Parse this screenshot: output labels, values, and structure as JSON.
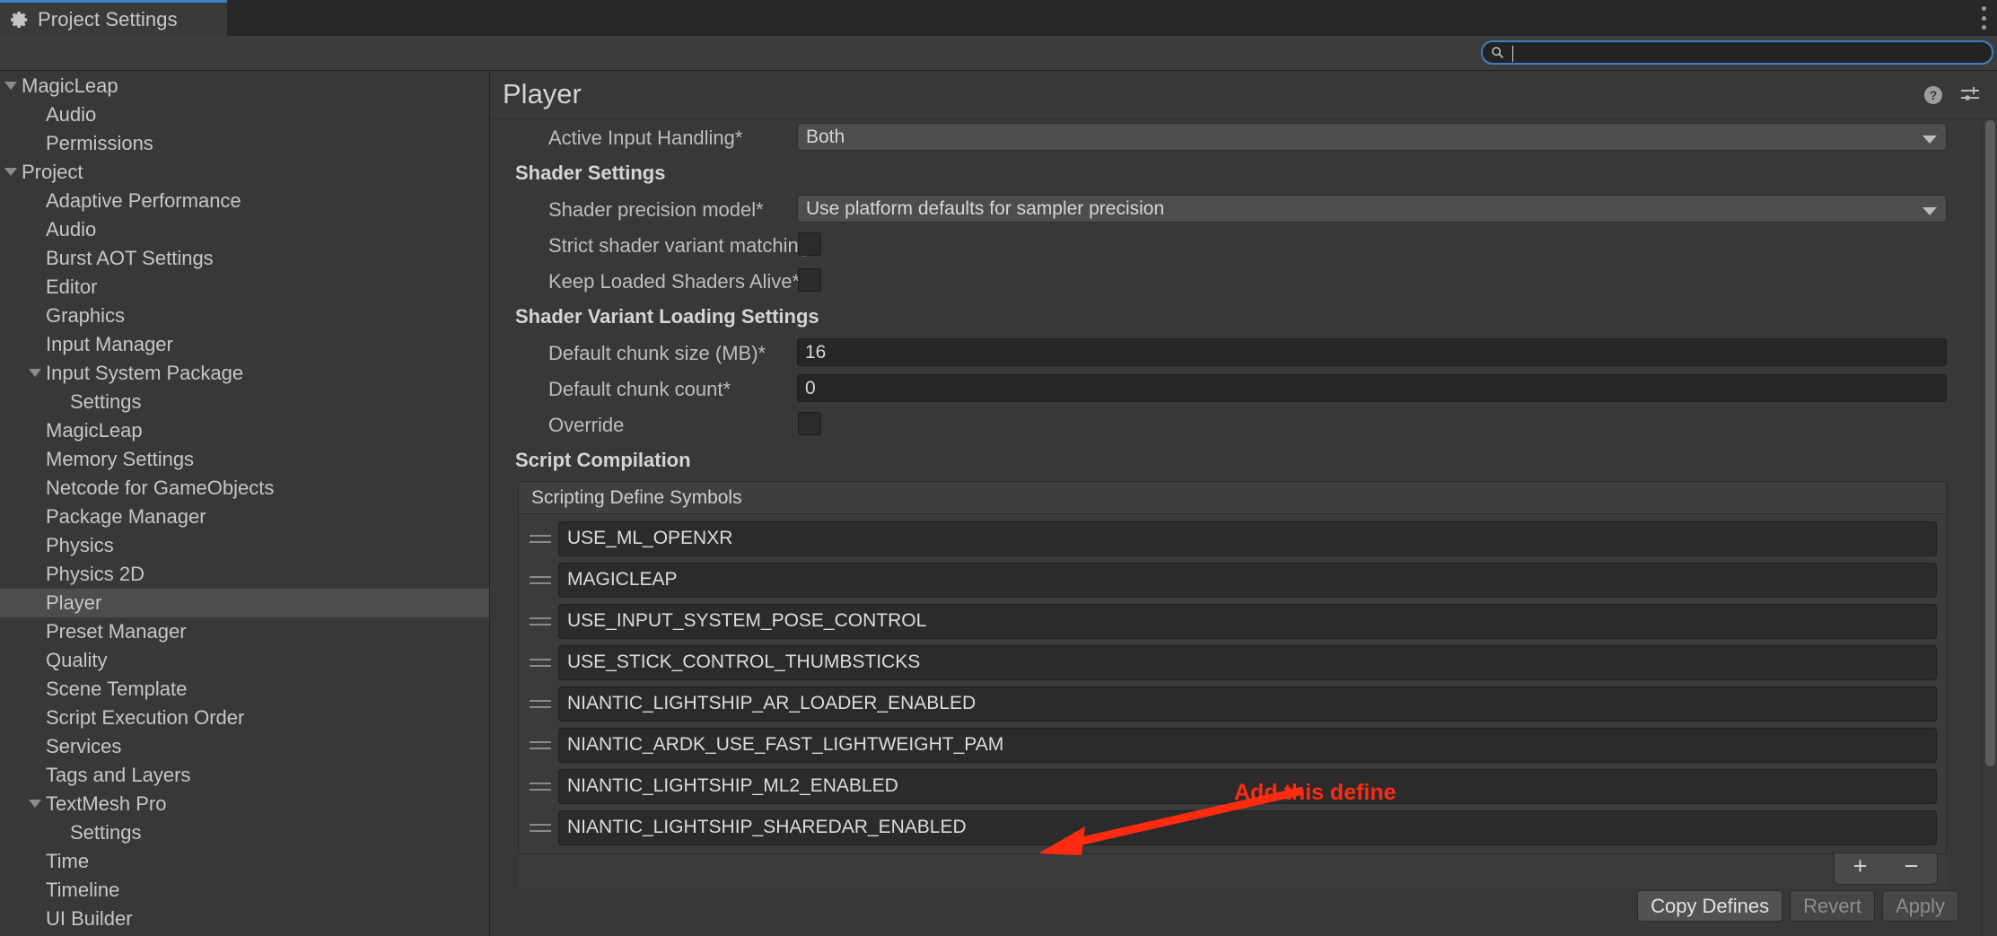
{
  "window": {
    "tab_label": "Project Settings",
    "gear_icon": "gear-icon",
    "kebab_icon": "kebab-menu-icon"
  },
  "search": {
    "icon": "search-icon",
    "value": "",
    "placeholder": ""
  },
  "sidebar": {
    "items": [
      {
        "label": "MagicLeap",
        "depth": 0,
        "expandable": true,
        "selected": false
      },
      {
        "label": "Audio",
        "depth": 1,
        "expandable": false,
        "selected": false
      },
      {
        "label": "Permissions",
        "depth": 1,
        "expandable": false,
        "selected": false
      },
      {
        "label": "Project",
        "depth": 0,
        "expandable": true,
        "selected": false
      },
      {
        "label": "Adaptive Performance",
        "depth": 1,
        "expandable": false,
        "selected": false
      },
      {
        "label": "Audio",
        "depth": 1,
        "expandable": false,
        "selected": false
      },
      {
        "label": "Burst AOT Settings",
        "depth": 1,
        "expandable": false,
        "selected": false
      },
      {
        "label": "Editor",
        "depth": 1,
        "expandable": false,
        "selected": false
      },
      {
        "label": "Graphics",
        "depth": 1,
        "expandable": false,
        "selected": false
      },
      {
        "label": "Input Manager",
        "depth": 1,
        "expandable": false,
        "selected": false
      },
      {
        "label": "Input System Package",
        "depth": 1,
        "expandable": true,
        "selected": false
      },
      {
        "label": "Settings",
        "depth": 2,
        "expandable": false,
        "selected": false
      },
      {
        "label": "MagicLeap",
        "depth": 1,
        "expandable": false,
        "selected": false
      },
      {
        "label": "Memory Settings",
        "depth": 1,
        "expandable": false,
        "selected": false
      },
      {
        "label": "Netcode for GameObjects",
        "depth": 1,
        "expandable": false,
        "selected": false
      },
      {
        "label": "Package Manager",
        "depth": 1,
        "expandable": false,
        "selected": false
      },
      {
        "label": "Physics",
        "depth": 1,
        "expandable": false,
        "selected": false
      },
      {
        "label": "Physics 2D",
        "depth": 1,
        "expandable": false,
        "selected": false
      },
      {
        "label": "Player",
        "depth": 1,
        "expandable": false,
        "selected": true
      },
      {
        "label": "Preset Manager",
        "depth": 1,
        "expandable": false,
        "selected": false
      },
      {
        "label": "Quality",
        "depth": 1,
        "expandable": false,
        "selected": false
      },
      {
        "label": "Scene Template",
        "depth": 1,
        "expandable": false,
        "selected": false
      },
      {
        "label": "Script Execution Order",
        "depth": 1,
        "expandable": false,
        "selected": false
      },
      {
        "label": "Services",
        "depth": 1,
        "expandable": false,
        "selected": false
      },
      {
        "label": "Tags and Layers",
        "depth": 1,
        "expandable": false,
        "selected": false
      },
      {
        "label": "TextMesh Pro",
        "depth": 1,
        "expandable": true,
        "selected": false
      },
      {
        "label": "Settings",
        "depth": 2,
        "expandable": false,
        "selected": false
      },
      {
        "label": "Time",
        "depth": 1,
        "expandable": false,
        "selected": false
      },
      {
        "label": "Timeline",
        "depth": 1,
        "expandable": false,
        "selected": false
      },
      {
        "label": "UI Builder",
        "depth": 1,
        "expandable": false,
        "selected": false
      }
    ]
  },
  "panel": {
    "title": "Player",
    "help_icon": "help-icon",
    "preset_icon": "preset-settings-icon",
    "rows": [
      {
        "kind": "field-dropdown",
        "label": "Active Input Handling*",
        "value": "Both"
      },
      {
        "kind": "section",
        "label": "Shader Settings"
      },
      {
        "kind": "field-dropdown",
        "label": "Shader precision model*",
        "value": "Use platform defaults for sampler precision"
      },
      {
        "kind": "checkbox",
        "label": "Strict shader variant matching*",
        "checked": false
      },
      {
        "kind": "checkbox",
        "label": "Keep Loaded Shaders Alive*",
        "checked": false
      },
      {
        "kind": "section",
        "label": "Shader Variant Loading Settings"
      },
      {
        "kind": "field-text",
        "label": "Default chunk size (MB)*",
        "value": "16"
      },
      {
        "kind": "field-text",
        "label": "Default chunk count*",
        "value": "0"
      },
      {
        "kind": "checkbox",
        "label": "Override",
        "checked": false
      },
      {
        "kind": "section",
        "label": "Script Compilation"
      }
    ]
  },
  "defines": {
    "header": "Scripting Define Symbols",
    "items": [
      "USE_ML_OPENXR",
      "MAGICLEAP",
      "USE_INPUT_SYSTEM_POSE_CONTROL",
      "USE_STICK_CONTROL_THUMBSTICKS",
      "NIANTIC_LIGHTSHIP_AR_LOADER_ENABLED",
      "NIANTIC_ARDK_USE_FAST_LIGHTWEIGHT_PAM",
      "NIANTIC_LIGHTSHIP_ML2_ENABLED",
      "NIANTIC_LIGHTSHIP_SHAREDAR_ENABLED"
    ],
    "add_label": "+",
    "remove_label": "−"
  },
  "footer": {
    "copy_defines": "Copy Defines",
    "revert": "Revert",
    "apply": "Apply"
  },
  "annotation": {
    "text": "Add this define",
    "color": "#ff2b10"
  }
}
